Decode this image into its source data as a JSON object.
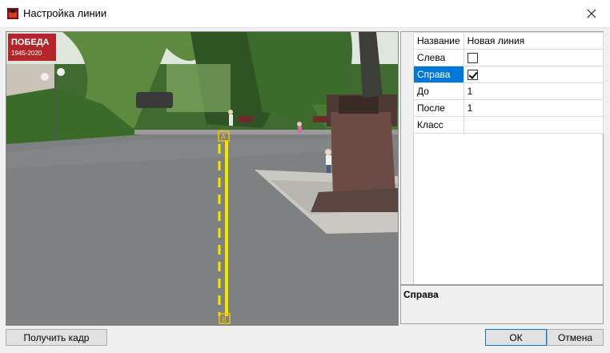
{
  "window": {
    "title": "Настройка линии"
  },
  "video": {
    "banner_text_line1": "ПОБЕДА",
    "banner_text_line2": "1945-2020",
    "line_marker_a": "A",
    "line_marker_b": "B"
  },
  "properties": [
    {
      "name": "Название",
      "value": "Новая линия",
      "type": "text"
    },
    {
      "name": "Слева",
      "value": false,
      "type": "checkbox"
    },
    {
      "name": "Справа",
      "value": true,
      "type": "checkbox",
      "selected": true
    },
    {
      "name": "До",
      "value": "1",
      "type": "text"
    },
    {
      "name": "После",
      "value": "1",
      "type": "text"
    },
    {
      "name": "Класс",
      "value": "",
      "type": "text"
    }
  ],
  "description": {
    "title": "Справа"
  },
  "buttons": {
    "get_frame": "Получить кадр",
    "ok": "ОК",
    "cancel": "Отмена"
  },
  "colors": {
    "selection": "#0078d7",
    "line": "#f5e600"
  }
}
